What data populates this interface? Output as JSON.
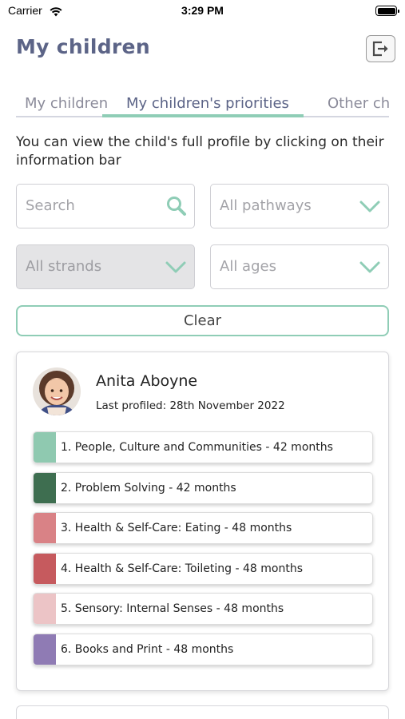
{
  "status_bar": {
    "carrier": "Carrier",
    "time": "3:29 PM"
  },
  "header": {
    "title": "My children",
    "logout_icon": "logout-icon"
  },
  "tabs": [
    {
      "label": "My children",
      "active": false
    },
    {
      "label": "My children's priorities",
      "active": true
    },
    {
      "label": "Other ch",
      "active": false
    }
  ],
  "intro_text": "You can view the child's full profile by clicking on their information bar",
  "filters": {
    "search_placeholder": "Search",
    "pathways": "All pathways",
    "strands": "All strands",
    "ages": "All ages",
    "clear_label": "Clear"
  },
  "child": {
    "name": "Anita Aboyne",
    "last_profiled": "Last profiled: 28th November 2022",
    "priorities": [
      {
        "label": "1. People, Culture and Communities - 42 months",
        "color": "#8fc9b0"
      },
      {
        "label": "2. Problem Solving - 42 months",
        "color": "#3e6e50"
      },
      {
        "label": "3. Health & Self-Care: Eating - 48 months",
        "color": "#d98286"
      },
      {
        "label": "4. Health & Self-Care: Toileting - 48 months",
        "color": "#c65a5e"
      },
      {
        "label": "5. Sensory: Internal Senses - 48 months",
        "color": "#ecc4c6"
      },
      {
        "label": "6. Books and Print - 48 months",
        "color": "#8f7bb4"
      }
    ]
  },
  "colors": {
    "accent": "#8fcdb6",
    "title": "#5c6487"
  }
}
